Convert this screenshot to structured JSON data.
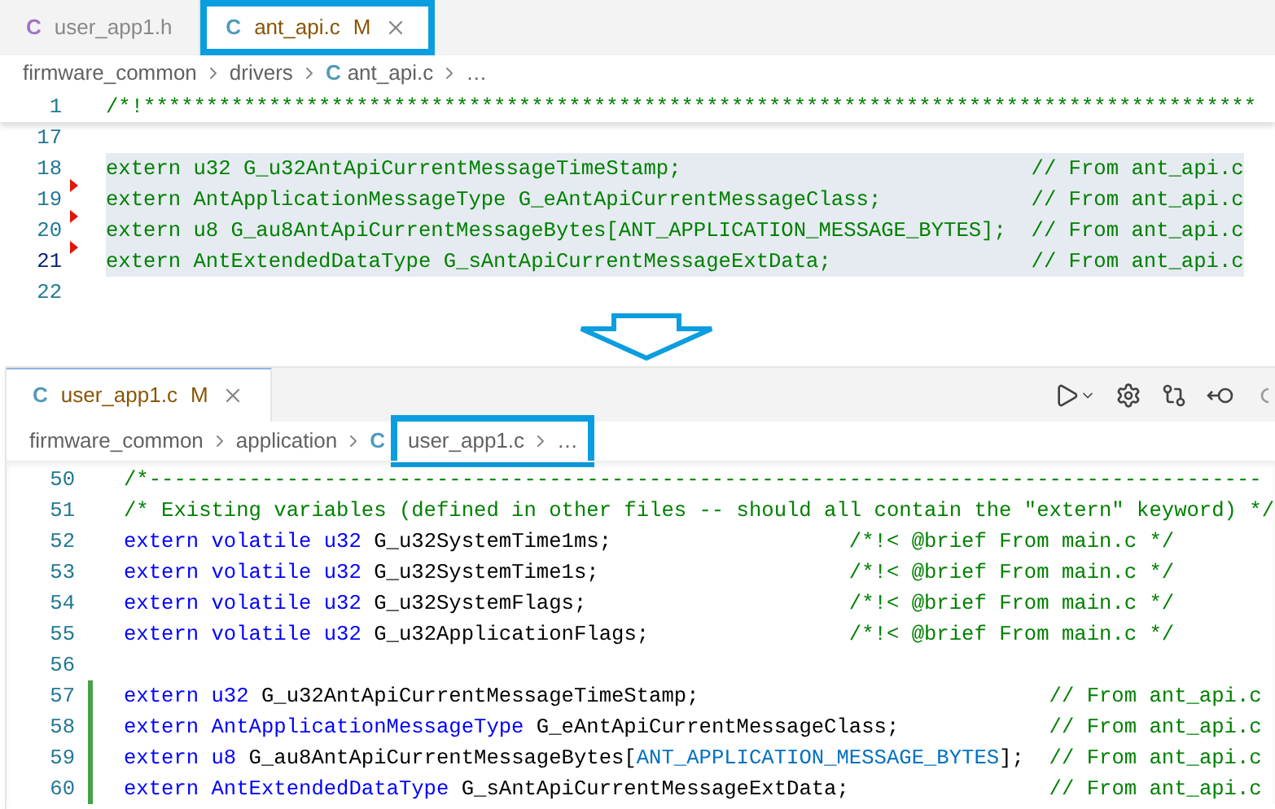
{
  "top_editor": {
    "tabs": [
      {
        "icon": "C",
        "color": "#a074c4",
        "label": "user_app1.h",
        "selected": false,
        "highlighted": false
      },
      {
        "icon": "C",
        "color": "#519aba",
        "label": "ant_api.c",
        "modified": "M",
        "selected": true,
        "highlighted": true
      }
    ],
    "breadcrumb": [
      {
        "label": "firmware_common",
        "highlighted": false
      },
      {
        "label": "drivers",
        "highlighted": false
      },
      {
        "label": "ant_api.c",
        "icon": "C",
        "highlighted": false
      },
      {
        "label": "…",
        "highlighted": false
      }
    ],
    "sticky_line": {
      "number": "1",
      "segments": [
        {
          "text": "/*!*****************************************************************************************",
          "kind": "comment"
        }
      ]
    },
    "lines": [
      {
        "number": "17",
        "current": false
      },
      {
        "number": "18",
        "segments": [
          {
            "text": "extern u32 G_u32AntApiCurrentMessageTimeStamp;                            // From ant_api.c",
            "kind": "comment"
          }
        ],
        "selected": true,
        "current": false
      },
      {
        "number": "19",
        "segments": [
          {
            "text": "extern AntApplicationMessageType G_eAntApiCurrentMessageClass;            // From ant_api.c",
            "kind": "comment"
          }
        ],
        "selected": true,
        "current": false,
        "deleted_marker": true
      },
      {
        "number": "20",
        "segments": [
          {
            "text": "extern u8 G_au8AntApiCurrentMessageBytes[ANT_APPLICATION_MESSAGE_BYTES];  // From ant_api.c",
            "kind": "comment"
          }
        ],
        "selected": true,
        "current": false,
        "deleted_marker": true
      },
      {
        "number": "21",
        "segments": [
          {
            "text": "extern AntExtendedDataType G_sAntApiCurrentMessageExtData;                // From ant_api.c",
            "kind": "comment"
          }
        ],
        "selected": true,
        "current": true,
        "deleted_marker": true
      },
      {
        "number": "22",
        "current": false
      }
    ]
  },
  "bottom_editor": {
    "tabs": [
      {
        "icon": "C",
        "color": "#519aba",
        "label": "user_app1.c",
        "modified": "M",
        "selected": true,
        "highlighted": false
      }
    ],
    "breadcrumb": [
      {
        "label": "firmware_common",
        "highlighted": false
      },
      {
        "label": "application",
        "highlighted": false
      },
      {
        "label": "user_app1.c",
        "icon": "C",
        "highlighted": true
      },
      {
        "label": "…",
        "highlighted": true
      }
    ],
    "lines": [
      {
        "number": "50",
        "segments": [
          {
            "text": "/*-----------------------------------------------------------------------------------------",
            "kind": "comment"
          }
        ]
      },
      {
        "number": "51",
        "segments": [
          {
            "text": "/* Existing variables (defined in other files -- should all contain the \"extern\" keyword) */",
            "kind": "comment"
          }
        ]
      },
      {
        "number": "52",
        "segments": [
          {
            "text": "extern volatile u32",
            "kind": "keyword"
          },
          {
            "text": " G_u32SystemTime1ms;                   ",
            "kind": "plain"
          },
          {
            "text": "/*!< @brief From main.c */",
            "kind": "comment"
          }
        ]
      },
      {
        "number": "53",
        "segments": [
          {
            "text": "extern volatile u32",
            "kind": "keyword"
          },
          {
            "text": " G_u32SystemTime1s;                    ",
            "kind": "plain"
          },
          {
            "text": "/*!< @brief From main.c */",
            "kind": "comment"
          }
        ]
      },
      {
        "number": "54",
        "segments": [
          {
            "text": "extern volatile u32",
            "kind": "keyword"
          },
          {
            "text": " G_u32SystemFlags;                     ",
            "kind": "plain"
          },
          {
            "text": "/*!< @brief From main.c */",
            "kind": "comment"
          }
        ]
      },
      {
        "number": "55",
        "segments": [
          {
            "text": "extern volatile u32",
            "kind": "keyword"
          },
          {
            "text": " G_u32ApplicationFlags;                ",
            "kind": "plain"
          },
          {
            "text": "/*!< @brief From main.c */",
            "kind": "comment"
          }
        ]
      },
      {
        "number": "56"
      },
      {
        "number": "57",
        "segments": [
          {
            "text": "extern u32",
            "kind": "keyword"
          },
          {
            "text": " G_u32AntApiCurrentMessageTimeStamp;                            ",
            "kind": "plain"
          },
          {
            "text": "// From ant_api.c",
            "kind": "comment"
          }
        ],
        "added": true
      },
      {
        "number": "58",
        "segments": [
          {
            "text": "extern AntApplicationMessageType",
            "kind": "keyword"
          },
          {
            "text": " G_eAntApiCurrentMessageClass;            ",
            "kind": "plain"
          },
          {
            "text": "// From ant_api.c",
            "kind": "comment"
          }
        ],
        "added": true
      },
      {
        "number": "59",
        "segments": [
          {
            "text": "extern u8",
            "kind": "keyword"
          },
          {
            "text": " G_au8AntApiCurrentMessageBytes[",
            "kind": "plain"
          },
          {
            "text": "ANT_APPLICATION_MESSAGE_BYTES",
            "kind": "macro"
          },
          {
            "text": "];  ",
            "kind": "plain"
          },
          {
            "text": "// From ant_api.c",
            "kind": "comment"
          }
        ],
        "added": true
      },
      {
        "number": "60",
        "segments": [
          {
            "text": "extern AntExtendedDataType",
            "kind": "keyword"
          },
          {
            "text": " G_sAntApiCurrentMessageExtData;                ",
            "kind": "plain"
          },
          {
            "text": "// From ant_api.c",
            "kind": "comment"
          }
        ],
        "added": true
      }
    ]
  }
}
